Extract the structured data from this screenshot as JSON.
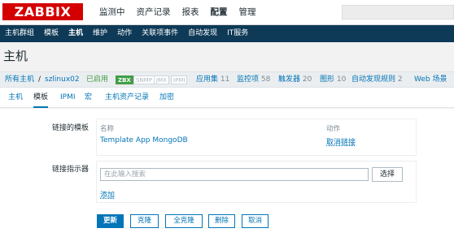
{
  "logo": "ZABBIX",
  "top_menu": [
    "监测中",
    "资产记录",
    "报表",
    "配置",
    "管理"
  ],
  "sub_menu": [
    "主机群组",
    "模板",
    "主机",
    "维护",
    "动作",
    "关联项事件",
    "自动发现",
    "IT服务"
  ],
  "page_title": "主机",
  "host_bar": {
    "all_hosts": "所有主机",
    "separator": "/",
    "host_name": "szlinux02",
    "status": "已启用",
    "tags": [
      "ZBX",
      "SNMP",
      "JMX",
      "IPMI"
    ],
    "apps_label": "应用集",
    "apps_count": "11",
    "items_label": "监控项",
    "items_count": "58",
    "triggers_label": "触发器",
    "triggers_count": "20",
    "graphs_label": "图形",
    "graphs_count": "10",
    "discovery_label": "自动发现规则",
    "discovery_count": "2",
    "web_label": "Web 场景"
  },
  "tabs": [
    "主机",
    "模板",
    "IPMI",
    "宏",
    "主机资产记录",
    "加密"
  ],
  "form": {
    "linked_label": "链接的模板",
    "col_name": "名称",
    "col_action": "动作",
    "template_name": "Template App MongoDB",
    "unlink": "取消链接",
    "link_indicator_label": "链接指示器",
    "search_placeholder": "在此输入搜索",
    "select_btn": "选择",
    "add_link": "添加"
  },
  "buttons": [
    "更新",
    "克隆",
    "全克隆",
    "删除",
    "取消"
  ],
  "colors": {
    "brand": "#d40000",
    "nav": "#0e3a57",
    "link": "#0275b8",
    "status": "#429e47"
  }
}
